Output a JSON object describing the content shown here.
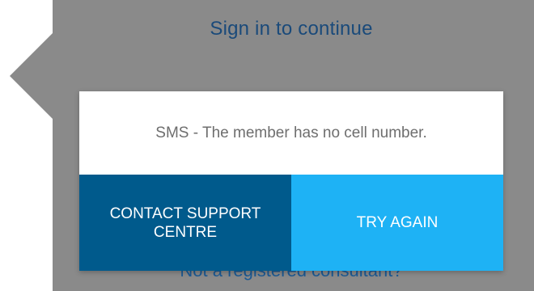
{
  "panel": {
    "title": "Sign in to continue",
    "footer_link": "Not a registered consultant?",
    "background_color": "#8a8a8a"
  },
  "dialog": {
    "message": "SMS - The member has no cell number.",
    "actions": {
      "contact_label": "CONTACT SUPPORT\nCENTRE",
      "retry_label": "TRY AGAIN"
    },
    "colors": {
      "contact_button": "#005a8c",
      "retry_button": "#1eb2f5",
      "body": "#ffffff"
    }
  }
}
